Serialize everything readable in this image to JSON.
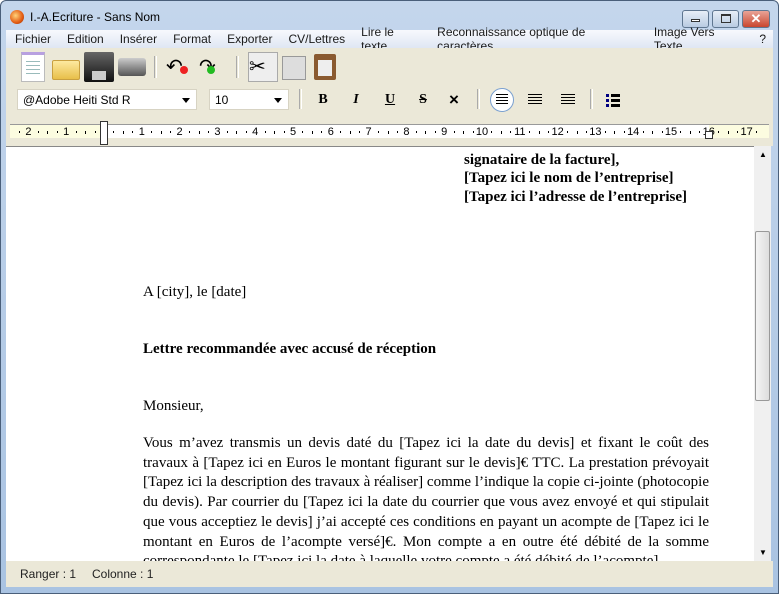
{
  "window": {
    "title": "I.-A.Ecriture - Sans Nom"
  },
  "menu": [
    "Fichier",
    "Edition",
    "Insérer",
    "Format",
    "Exporter",
    "CV/Lettres",
    "Lire le texte",
    "Reconnaissance optique de caractères",
    "Image Vers Texte",
    "?"
  ],
  "toolbar": {
    "icons": [
      "new-document-icon",
      "open-folder-icon",
      "save-icon",
      "print-icon",
      "undo-icon",
      "redo-icon",
      "cut-icon",
      "copy-icon",
      "paste-icon"
    ]
  },
  "format": {
    "font": "@Adobe Heiti Std R",
    "size": "10",
    "bold": "B",
    "italic": "I",
    "underline": "U",
    "strike": "S",
    "clear": "×",
    "alignment": "left"
  },
  "ruler": {
    "labels": [
      "2",
      "1",
      "1",
      "2",
      "3",
      "4",
      "5",
      "6",
      "7",
      "8",
      "9",
      "10",
      "11",
      "12",
      "13",
      "14",
      "15",
      "16",
      "17"
    ]
  },
  "document": {
    "address": [
      "signataire de la facture],",
      "[Tapez ici le nom de l’entreprise]",
      "[Tapez ici l’adresse de l’entreprise]"
    ],
    "place_date": "A [city], le [date]",
    "subject": "Lettre recommandée avec accusé de réception",
    "salutation": "Monsieur,",
    "body": "Vous m’avez transmis un devis daté du [Tapez ici la date du devis] et fixant le coût des travaux à [Tapez ici en Euros le montant figurant sur le devis]€ TTC. La prestation prévoyait [Tapez ici la description des travaux à réaliser] comme l’indique la copie ci-jointe (photocopie du devis). Par courrier du [Tapez ici la date du courrier que vous avez envoyé et qui stipulait que vous acceptiez le devis] j’ai accepté ces conditions en payant un acompte de [Tapez ici le montant en Euros de l’acompte versé]€. Mon compte a en outre été débité de la somme correspondante le [Tapez ici la date à laquelle votre compte a été débité de l’acompte]."
  },
  "status": {
    "row": "Ranger : 1",
    "col": "Colonne : 1"
  }
}
